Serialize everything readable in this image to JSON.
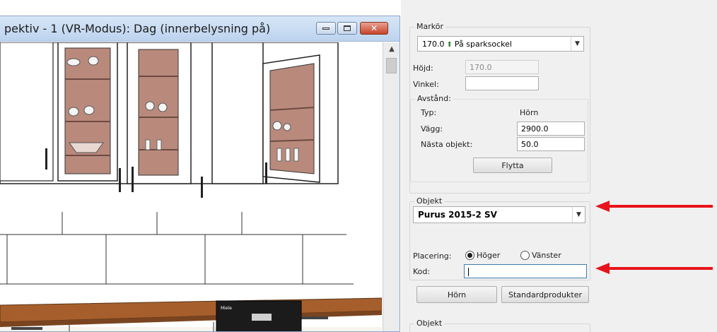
{
  "viewport": {
    "title": "pektiv - 1 (VR-Modus): Dag (innerbelysning på)",
    "buttons": {
      "minimize_icon": "minimize-icon",
      "maximize_icon": "maximize-icon",
      "close_icon": "close-icon",
      "close_glyph": "✕"
    },
    "scroll_up_glyph": "▲",
    "appliance_brand": "Miele"
  },
  "panel": {
    "marker_group": {
      "legend": "Markör",
      "selected": {
        "value": "170.0",
        "icon": "up-arrow-icon",
        "arrow_glyph": "⬆",
        "label": "På sparksockel"
      },
      "height_label": "Höjd:",
      "height_value": "170.0",
      "angle_label": "Vinkel:",
      "angle_value": ""
    },
    "distance_group": {
      "legend": "Avstånd:",
      "type_label": "Typ:",
      "type_value": "Hörn",
      "wall_label": "Vägg:",
      "wall_value": "2900.0",
      "next_label": "Nästa objekt:",
      "next_value": "50.0",
      "move_button": "Flytta"
    },
    "object_group": {
      "legend": "Objekt",
      "selected": "Purus 2015-2 SV",
      "placement_label": "Placering:",
      "right_option": "Höger",
      "left_option": "Vänster",
      "placement_selected": "Höger",
      "code_label": "Kod:",
      "code_value": ""
    },
    "buttons": {
      "corner": "Hörn",
      "standard": "Standardprodukter"
    },
    "object_group_2": {
      "legend": "Objekt"
    }
  },
  "annotation": {
    "color": "#e8141b"
  },
  "colors": {
    "glass": "#b98a7c",
    "countertop": "#a65f2c",
    "cabinet": "#ffffff"
  }
}
